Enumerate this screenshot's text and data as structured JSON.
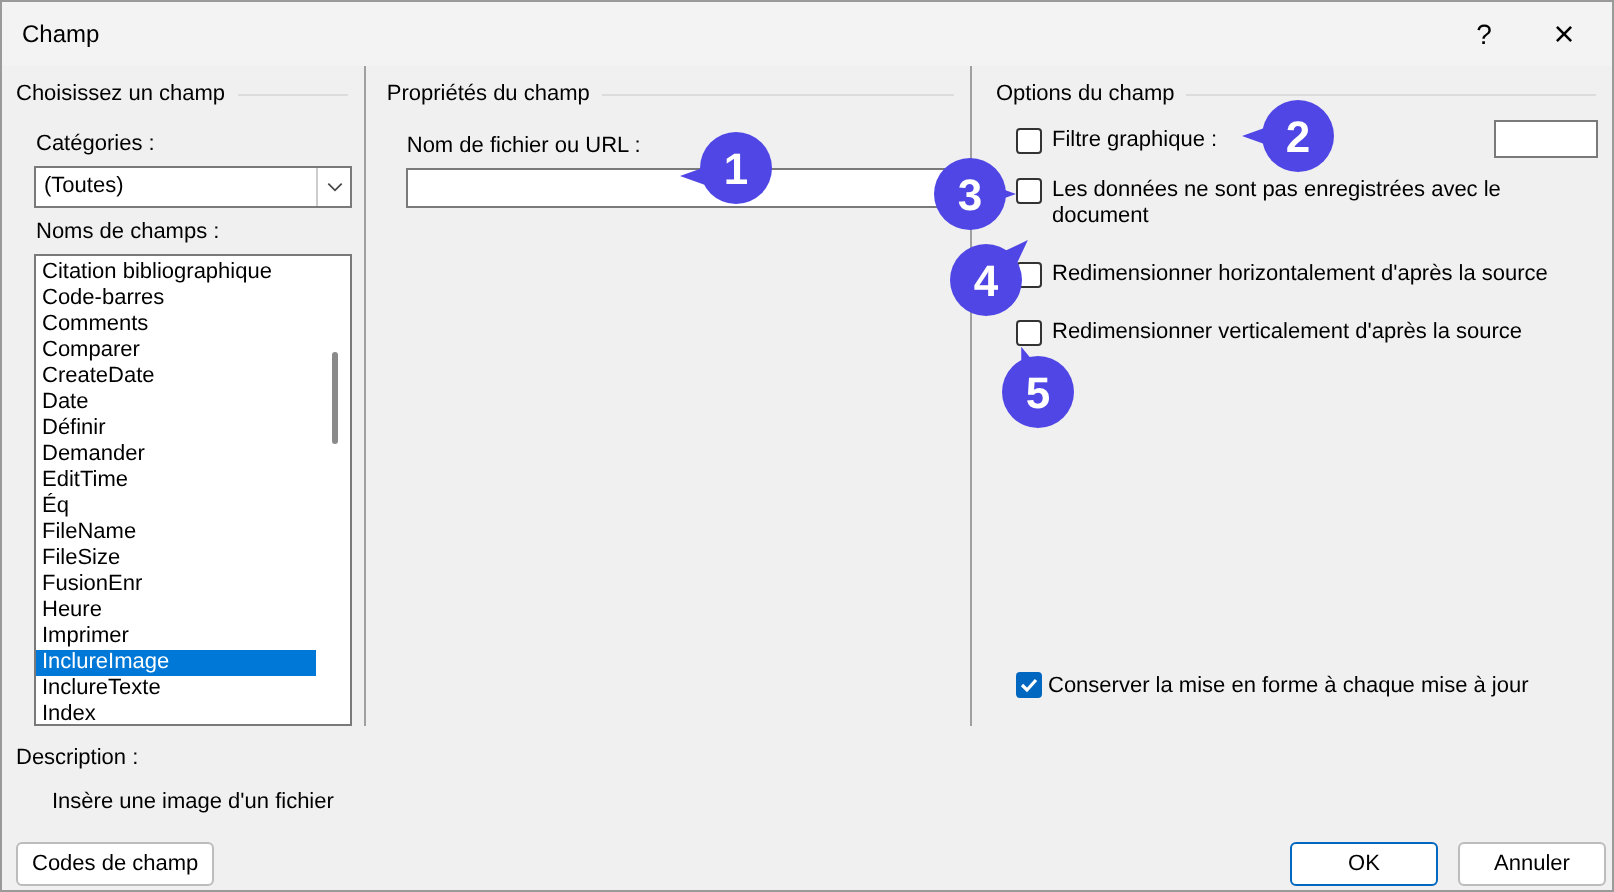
{
  "window": {
    "title": "Champ",
    "help": "?",
    "close": "×"
  },
  "choose_panel": {
    "heading": "Choisissez un champ",
    "categories_label": "Catégories :",
    "categories_value": "(Toutes)",
    "names_label": "Noms de champs :",
    "field_names": [
      {
        "label": "Citation bibliographique",
        "selected": false
      },
      {
        "label": "Code-barres",
        "selected": false
      },
      {
        "label": "Comments",
        "selected": false
      },
      {
        "label": "Comparer",
        "selected": false
      },
      {
        "label": "CreateDate",
        "selected": false
      },
      {
        "label": "Date",
        "selected": false
      },
      {
        "label": "Définir",
        "selected": false
      },
      {
        "label": "Demander",
        "selected": false
      },
      {
        "label": "EditTime",
        "selected": false
      },
      {
        "label": "Éq",
        "selected": false
      },
      {
        "label": "FileName",
        "selected": false
      },
      {
        "label": "FileSize",
        "selected": false
      },
      {
        "label": "FusionEnr",
        "selected": false
      },
      {
        "label": "Heure",
        "selected": false
      },
      {
        "label": "Imprimer",
        "selected": false
      },
      {
        "label": "InclureImage",
        "selected": true
      },
      {
        "label": "InclureTexte",
        "selected": false
      },
      {
        "label": "Index",
        "selected": false
      }
    ]
  },
  "properties_panel": {
    "heading": "Propriétés du champ",
    "filename_label": "Nom de fichier ou URL :"
  },
  "options_panel": {
    "heading": "Options du champ",
    "options": [
      {
        "kind": "with_field",
        "label": "Filtre graphique :",
        "checked": false
      },
      {
        "kind": "plain",
        "label": "Les données ne sont pas enregistrées avec le document",
        "checked": false
      },
      {
        "kind": "plain",
        "label": "Redimensionner horizontalement d'après la source",
        "checked": false
      },
      {
        "kind": "plain",
        "label": "Redimensionner verticalement d'après la source",
        "checked": false
      }
    ],
    "preserve_formatting": {
      "label": "Conserver la mise en forme à chaque mise à jour",
      "checked": true
    }
  },
  "description": {
    "label": "Description :",
    "text": "Insère une image d'un fichier"
  },
  "buttons": {
    "field_codes": "Codes de champ",
    "ok": "OK",
    "cancel": "Annuler"
  },
  "callouts": [
    {
      "number": "1"
    },
    {
      "number": "2"
    },
    {
      "number": "3"
    },
    {
      "number": "4"
    },
    {
      "number": "5"
    }
  ]
}
